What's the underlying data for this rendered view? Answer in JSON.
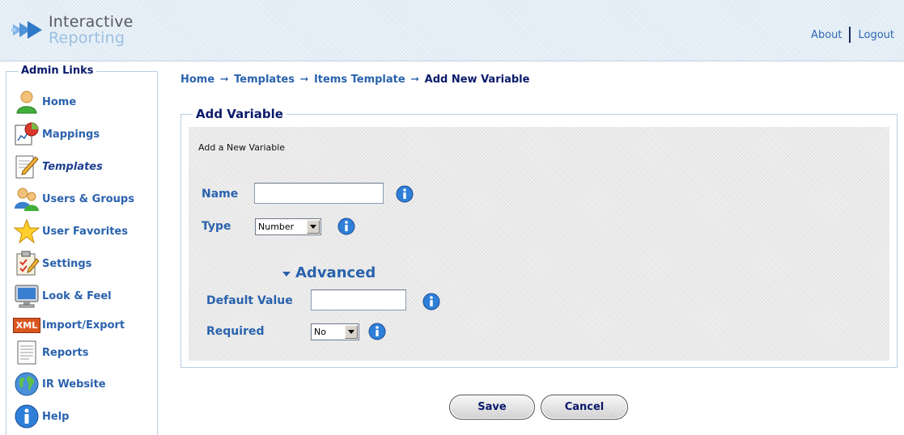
{
  "header": {
    "logo_line1": "Interactive",
    "logo_line2": "Reporting",
    "about_label": "About",
    "logout_label": "Logout"
  },
  "sidebar": {
    "title": "Admin Links",
    "items": [
      {
        "label": "Home",
        "icon": "user-icon"
      },
      {
        "label": "Mappings",
        "icon": "mappings-icon"
      },
      {
        "label": "Templates",
        "icon": "pencil-document-icon",
        "active": true
      },
      {
        "label": "Users & Groups",
        "icon": "users-icon"
      },
      {
        "label": "User Favorites",
        "icon": "star-icon"
      },
      {
        "label": "Settings",
        "icon": "clipboard-check-icon"
      },
      {
        "label": "Look & Feel",
        "icon": "monitor-icon"
      },
      {
        "label": "Import/Export",
        "icon": "xml-icon",
        "icon_text": "XML"
      },
      {
        "label": "Reports",
        "icon": "report-document-icon"
      },
      {
        "label": "IR Website",
        "icon": "globe-icon"
      },
      {
        "label": "Help",
        "icon": "help-info-icon"
      }
    ]
  },
  "breadcrumb": {
    "items": [
      "Home",
      "Templates",
      "Items Template",
      "Add New Variable"
    ],
    "separator": "➞"
  },
  "form": {
    "legend": "Add Variable",
    "subtitle": "Add a New Variable",
    "name_label": "Name",
    "name_value": "",
    "type_label": "Type",
    "type_value": "Number",
    "advanced_label": "Advanced",
    "default_value_label": "Default Value",
    "default_value": "",
    "required_label": "Required",
    "required_value": "No"
  },
  "buttons": {
    "save_label": "Save",
    "cancel_label": "Cancel"
  },
  "colors": {
    "link_blue": "#2a62ad",
    "dark_navy": "#0a1a6a",
    "panel_border": "#b9cfe3",
    "info_blue": "#2f7fd8"
  }
}
